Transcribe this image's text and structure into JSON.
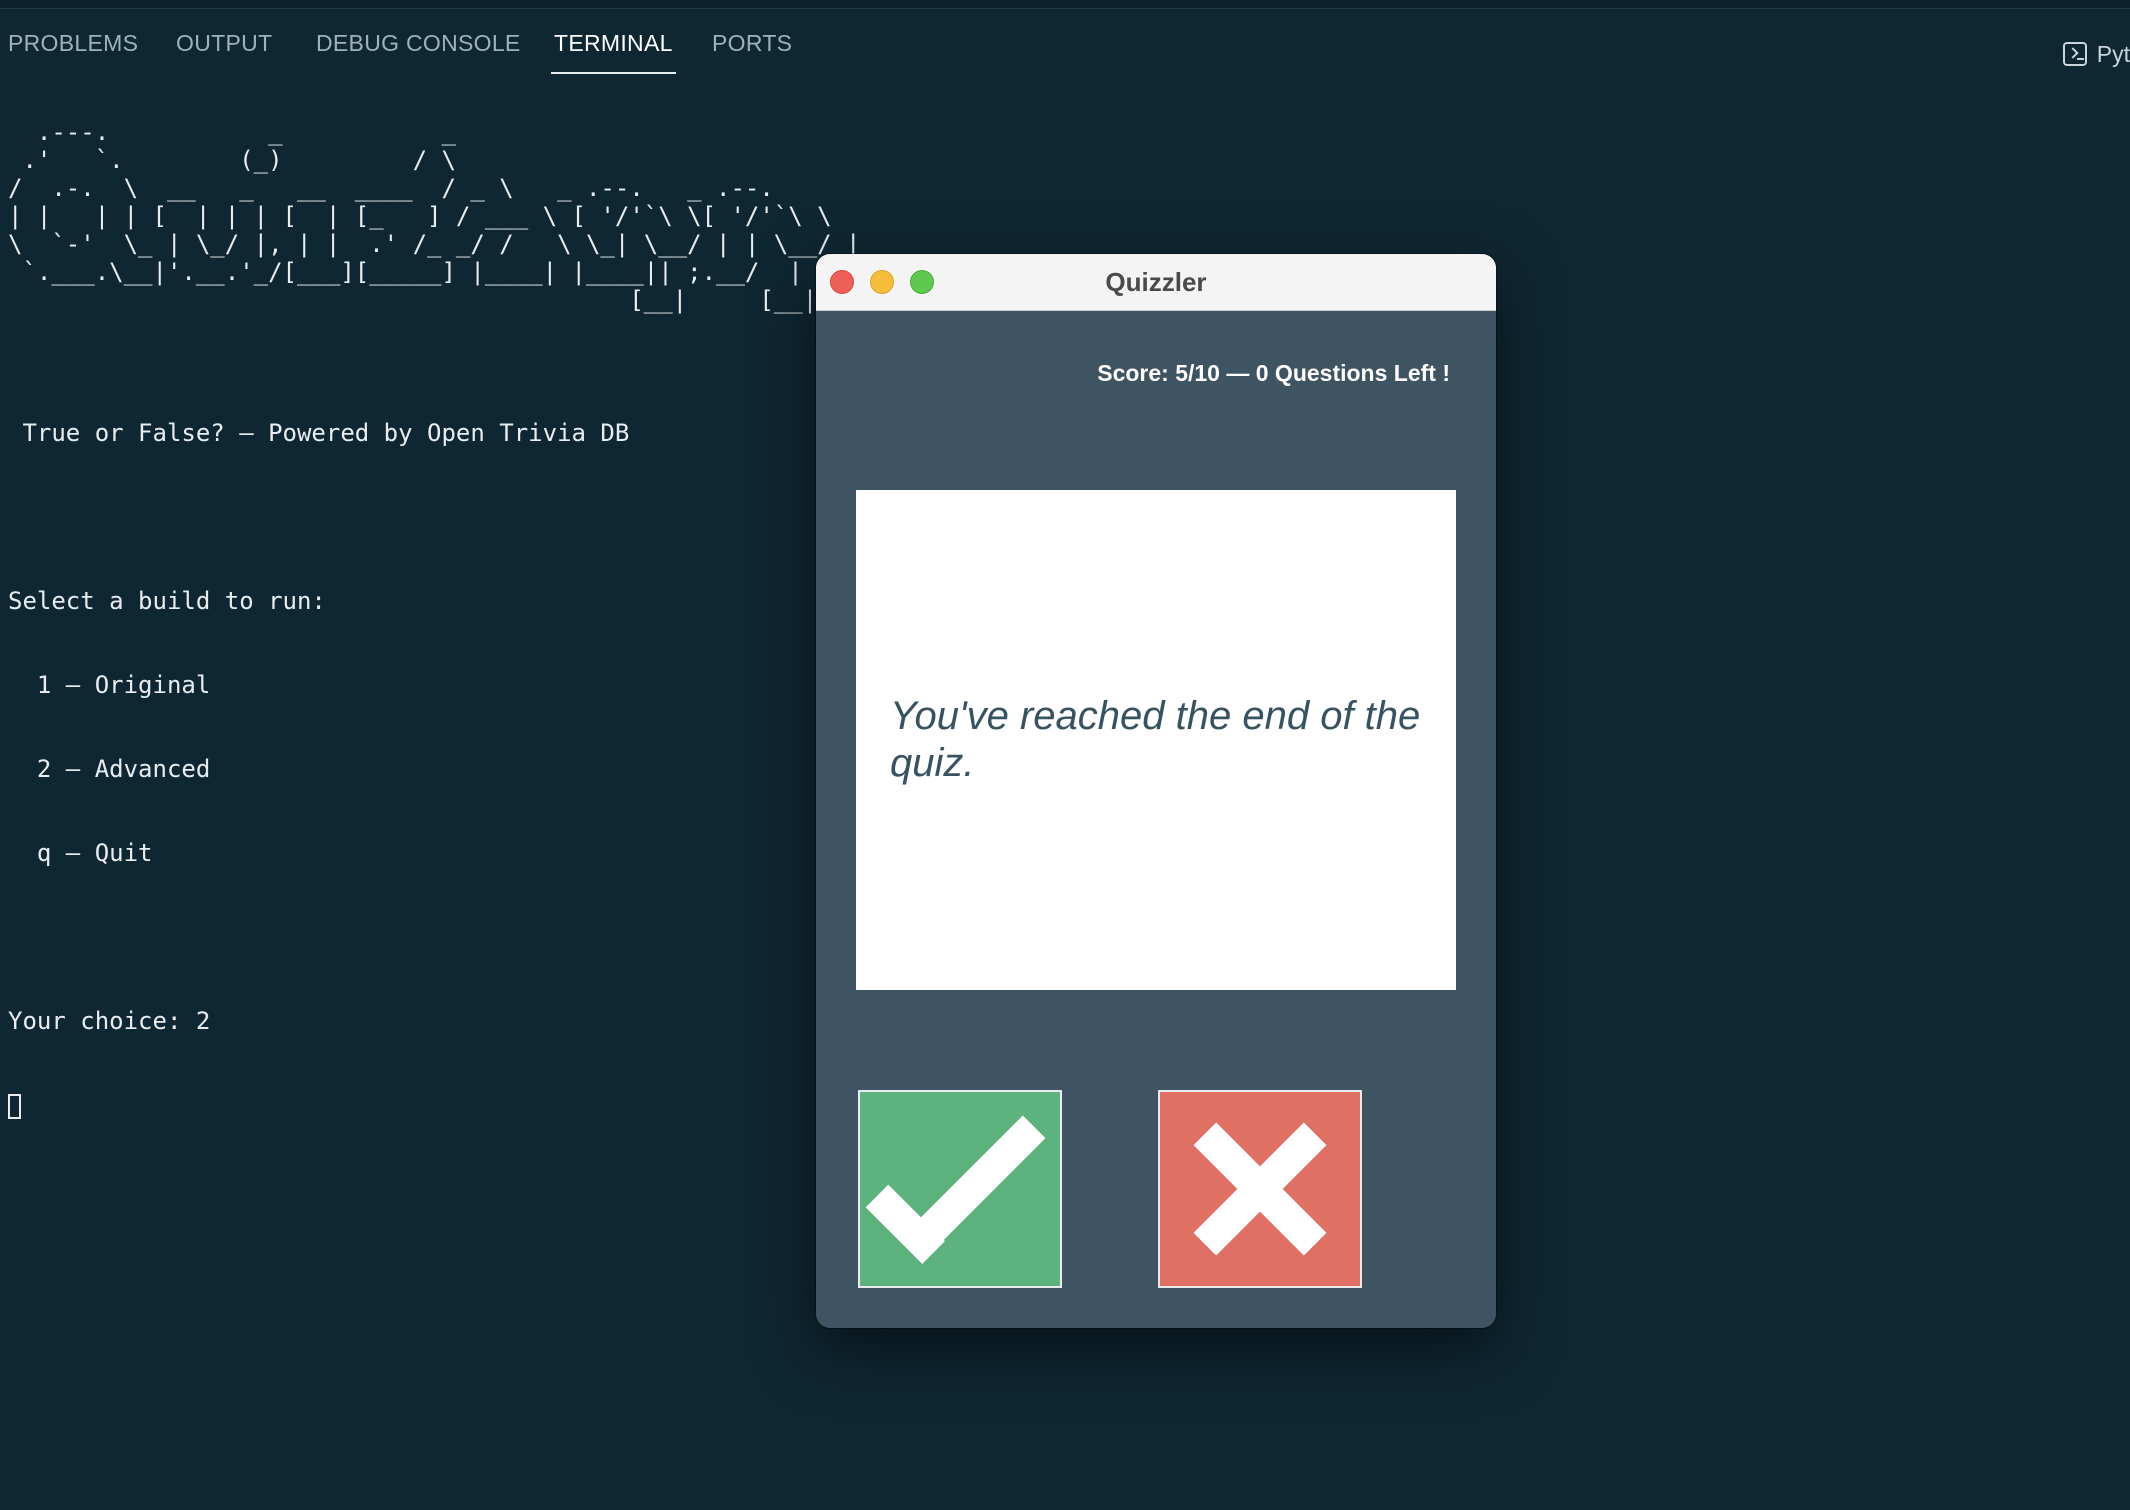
{
  "panel": {
    "tabs": [
      {
        "label": "PROBLEMS"
      },
      {
        "label": "OUTPUT"
      },
      {
        "label": "DEBUG CONSOLE"
      },
      {
        "label": "TERMINAL",
        "active": true
      },
      {
        "label": "PORTS"
      }
    ],
    "terminal_kind_label": "Pyt"
  },
  "terminal": {
    "banner": "  .---.           _           _\n .'   `.        (_)         / \\\n/  .-.  \\  __   _   __  ____  / _ \\   _ .--.   _ .--.\n| |   | | [  | | | [  | [_   ] / ___ \\ [ '/'`\\ \\[ '/'`\\ \\\n\\  `-'  \\_ | \\_/ |, | |  .' /_ _/ /   \\ \\_| \\__/ | | \\__/ |\n `.___.\\__|'.__.'_/[___][_____] |____| |____|| ;.__/  | ;.__/\n                                           [__|     [__|",
    "subtitle": " True or False? — Powered by Open Trivia DB",
    "prompt_header": "Select a build to run:",
    "options": [
      "  1 — Original",
      "  2 — Advanced",
      "  q — Quit"
    ],
    "choice": "Your choice: 2"
  },
  "quiz_window": {
    "title": "Quizzler",
    "score_text": "Score: 5/10 — 0 Questions Left !",
    "question_text": "You've reached the end of the quiz.",
    "true_button_icon": "check-icon",
    "false_button_icon": "x-icon",
    "colors": {
      "window_bg": "#3f5463",
      "true": "#5cb37e",
      "false": "#e07064",
      "question_text": "#375362"
    }
  }
}
